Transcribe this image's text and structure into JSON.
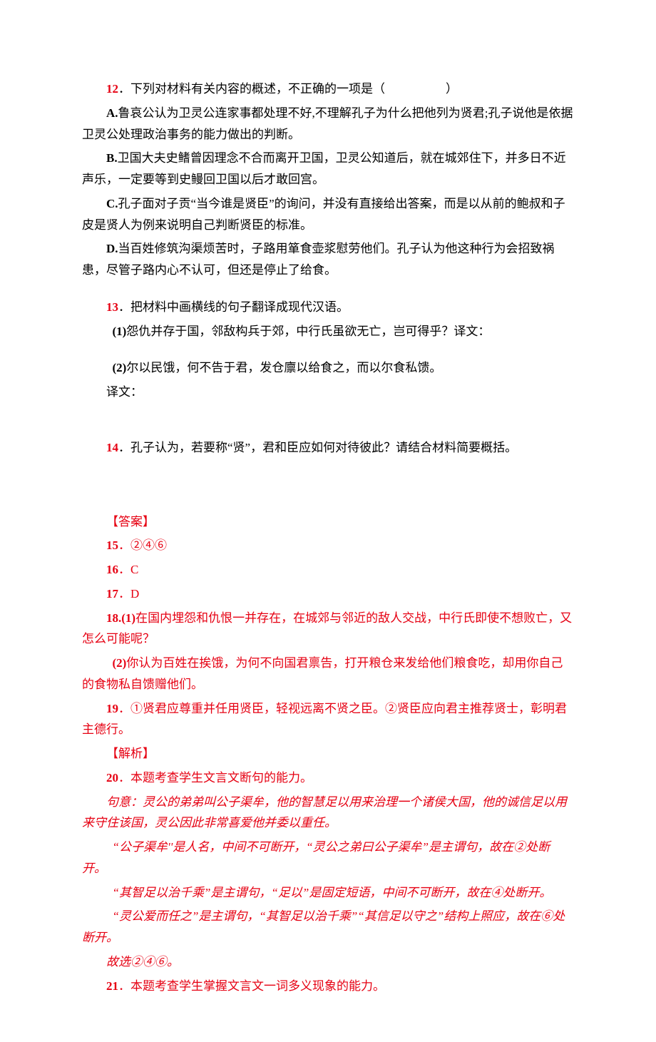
{
  "q12": {
    "stem_num": "12",
    "stem_text": "．下列对材料有关内容的概述，不正确的一项是（　　　　　）",
    "opt_a_label": "A.",
    "opt_a_text": "鲁哀公认为卫灵公连家事都处理不好,不理解孔子为什么把他列为贤君;孔子说他是依据卫灵公处理政治事务的能力做出的判断。",
    "opt_b_label": "B.",
    "opt_b_text": "卫国大夫史鳍曾因理念不合而离开卫国，卫灵公知道后，就在城郊住下，并多日不近声乐，一定要等到史鳗回卫国以后才敢回宫。",
    "opt_c_label": "C.",
    "opt_c_text": "孔子面对子贡“当今谁是贤臣”的询问，并没有直接给出答案，而是以从前的鲍叔和子皮是贤人为例来说明自己判断贤臣的标准。",
    "opt_d_label": "D.",
    "opt_d_text": "当百姓修筑沟渠烦苦时，子路用箪食壶浆慰劳他们。孔子认为他这种行为会招致祸患，尽管子路内心不认可，但还是停止了给食。"
  },
  "q13": {
    "num": "13",
    "stem": "．把材料中画横线的句子翻译成现代汉语。",
    "sub1_label": "(1)",
    "sub1_text": "怨仇并存于国，邻敌构兵于郊，中行氏虽欲无亡，岂可得乎？译文：",
    "sub2_label": "(2)",
    "sub2_text": "尔以民饿，何不告于君，发仓廪以给食之，而以尔食私馈。",
    "sub2_suffix": "译文："
  },
  "q14": {
    "num": "14",
    "stem": "．孔子认为，若要称“贤”，君和臣应如何对待彼此？请结合材料简要概括。"
  },
  "answers": {
    "header": "【答案】",
    "a15_num": "15",
    "a15_text": "．②④⑥",
    "a16_num": "16",
    "a16_text": "．C",
    "a17_num": "17",
    "a17_text": "．D",
    "a18_num": "18",
    "a18_sub1_label": ".(1)",
    "a18_sub1_text": "在国内埋怨和仇恨一并存在，在城郊与邻近的敌人交战，中行氏即使不想败亡，又怎么可能呢？",
    "a18_sub2_label": "(2)",
    "a18_sub2_text": "你认为百姓在挨饿，为何不向国君禀告，打开粮仓来发给他们粮食吃，却用你自己的食物私自馈赠他们。",
    "a19_num": "19",
    "a19_text": "．①贤君应尊重并任用贤臣，轻视远离不贤之臣。②贤臣应向君主推荐贤士，彰明君主德行。",
    "explain_header": "【解析】",
    "a20_num": "20",
    "a20_text": "．本题考查学生文言文断句的能力。",
    "a20_p1": "句意：灵公的弟弟叫公子渠牟，他的智慧足以用来治理一个诸侯大国，他的诚信足以用来守住该国，灵公因此非常喜爱他并委以重任。",
    "a20_p2": "“公子渠牟''是人名，中间不可断开，“灵公之弟曰公子渠牟”是主谓句，故在②处断开。",
    "a20_p3": "“其智足以治千乘”是主谓句，“足以”是固定短语，中间不可断开，故在④处断开。",
    "a20_p4": "“灵公爱而任之”是主谓句，“其智足以治千乘”“其信足以守之”结构上照应，故在⑥处断开。",
    "a20_p5": "故选②④⑥。",
    "a21_num": "21",
    "a21_text": "．本题考查学生掌握文言文一词多义现象的能力。"
  }
}
